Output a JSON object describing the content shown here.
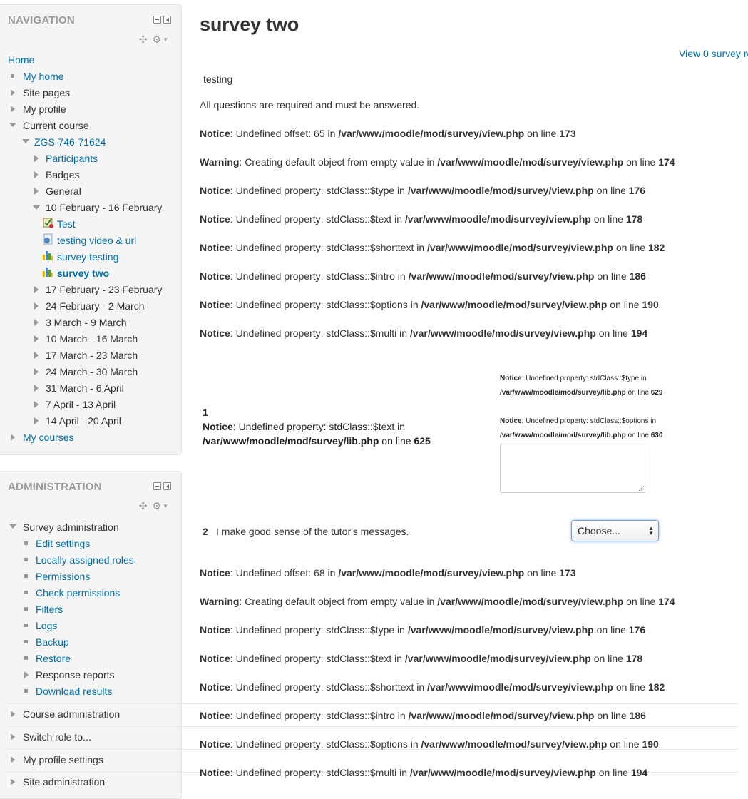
{
  "navigation": {
    "title": "NAVIGATION",
    "home": "Home",
    "my_home": "My home",
    "site_pages": "Site pages",
    "my_profile": "My profile",
    "current_course": "Current course",
    "course_code": "ZGS-746-71624",
    "participants": "Participants",
    "badges": "Badges",
    "general": "General",
    "week_current": "10 February - 16 February",
    "mod_test": "Test",
    "mod_video": "testing video & url",
    "mod_survey_testing": "survey testing",
    "mod_survey_two": "survey two",
    "weeks": [
      "17 February - 23 February",
      "24 February - 2 March",
      "3 March - 9 March",
      "10 March - 16 March",
      "17 March - 23 March",
      "24 March - 30 March",
      "31 March - 6 April",
      "7 April - 13 April",
      "14 April - 20 April"
    ],
    "my_courses": "My courses"
  },
  "administration": {
    "title": "ADMINISTRATION",
    "survey_admin": "Survey administration",
    "items": [
      "Edit settings",
      "Locally assigned roles",
      "Permissions",
      "Check permissions",
      "Filters",
      "Logs",
      "Backup",
      "Restore",
      "Response reports",
      "Download results"
    ],
    "course_admin": "Course administration",
    "switch_role": "Switch role to...",
    "profile_settings": "My profile settings",
    "site_admin": "Site administration"
  },
  "main": {
    "title": "survey two",
    "view_responses": "View 0 survey re",
    "intro": "testing",
    "required_note": "All questions are required and must be answered.",
    "notices_top": [
      {
        "type": "Notice",
        "msg": ": Undefined offset: 65 in ",
        "file": "/var/www/moodle/mod/survey/view.php",
        "on": " on line ",
        "line": "173"
      },
      {
        "type": "Warning",
        "msg": ": Creating default object from empty value in ",
        "file": "/var/www/moodle/mod/survey/view.php",
        "on": " on line ",
        "line": "174"
      },
      {
        "type": "Notice",
        "msg": ": Undefined property: stdClass::$type in ",
        "file": "/var/www/moodle/mod/survey/view.php",
        "on": " on line ",
        "line": "176"
      },
      {
        "type": "Notice",
        "msg": ": Undefined property: stdClass::$text in ",
        "file": "/var/www/moodle/mod/survey/view.php",
        "on": " on line ",
        "line": "178"
      },
      {
        "type": "Notice",
        "msg": ": Undefined property: stdClass::$shorttext in ",
        "file": "/var/www/moodle/mod/survey/view.php",
        "on": " on line ",
        "line": "182"
      },
      {
        "type": "Notice",
        "msg": ": Undefined property: stdClass::$intro in ",
        "file": "/var/www/moodle/mod/survey/view.php",
        "on": " on line ",
        "line": "186"
      },
      {
        "type": "Notice",
        "msg": ": Undefined property: stdClass::$options in ",
        "file": "/var/www/moodle/mod/survey/view.php",
        "on": " on line ",
        "line": "190"
      },
      {
        "type": "Notice",
        "msg": ": Undefined property: stdClass::$multi in ",
        "file": "/var/www/moodle/mod/survey/view.php",
        "on": " on line ",
        "line": "194"
      }
    ],
    "q1": {
      "num": "1",
      "type": "Notice",
      "msg": ": Undefined property: stdClass::$text in",
      "file": "/var/www/moodle/mod/survey/lib.php",
      "on": " on line ",
      "line": "625",
      "side_notices": [
        {
          "type": "Notice",
          "msg": ": Undefined property: stdClass::$type in",
          "file": "/var/www/moodle/mod/survey/lib.php",
          "on": " on line ",
          "line": "629"
        },
        {
          "type": "Notice",
          "msg": ": Undefined property: stdClass::$options in",
          "file": "/var/www/moodle/mod/survey/lib.php",
          "on": " on line ",
          "line": "630"
        }
      ]
    },
    "q2": {
      "num": "2",
      "text": "I make good sense of the tutor's messages.",
      "select_value": "Choose..."
    },
    "notices_bottom": [
      {
        "type": "Notice",
        "msg": ": Undefined offset: 68 in ",
        "file": "/var/www/moodle/mod/survey/view.php",
        "on": " on line ",
        "line": "173"
      },
      {
        "type": "Warning",
        "msg": ": Creating default object from empty value in ",
        "file": "/var/www/moodle/mod/survey/view.php",
        "on": " on line ",
        "line": "174"
      },
      {
        "type": "Notice",
        "msg": ": Undefined property: stdClass::$type in ",
        "file": "/var/www/moodle/mod/survey/view.php",
        "on": " on line ",
        "line": "176"
      },
      {
        "type": "Notice",
        "msg": ": Undefined property: stdClass::$text in ",
        "file": "/var/www/moodle/mod/survey/view.php",
        "on": " on line ",
        "line": "178"
      },
      {
        "type": "Notice",
        "msg": ": Undefined property: stdClass::$shorttext in ",
        "file": "/var/www/moodle/mod/survey/view.php",
        "on": " on line ",
        "line": "182"
      },
      {
        "type": "Notice",
        "msg": ": Undefined property: stdClass::$intro in ",
        "file": "/var/www/moodle/mod/survey/view.php",
        "on": " on line ",
        "line": "186"
      },
      {
        "type": "Notice",
        "msg": ": Undefined property: stdClass::$options in ",
        "file": "/var/www/moodle/mod/survey/view.php",
        "on": " on line ",
        "line": "190"
      },
      {
        "type": "Notice",
        "msg": ": Undefined property: stdClass::$multi in ",
        "file": "/var/www/moodle/mod/survey/view.php",
        "on": " on line ",
        "line": "194"
      }
    ]
  }
}
